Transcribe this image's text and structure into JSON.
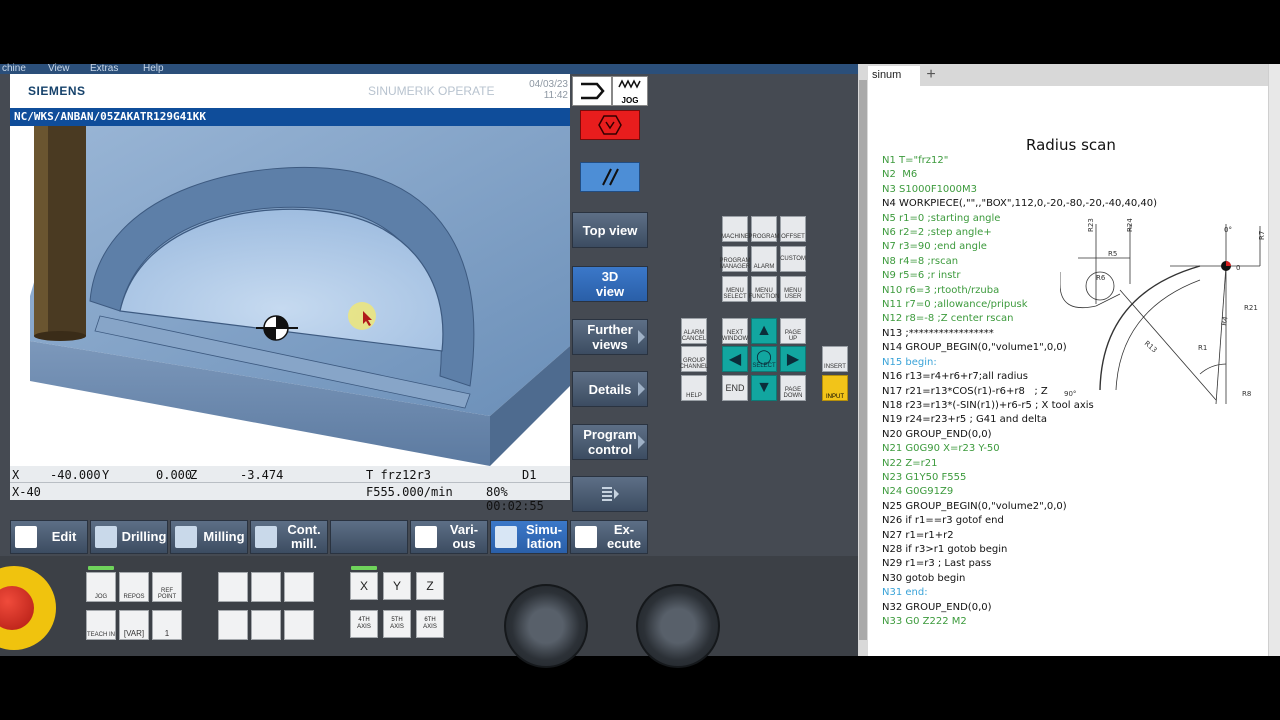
{
  "menu": [
    "chine",
    "View",
    "Extras",
    "Help"
  ],
  "header": {
    "brand": "SIEMENS",
    "product": "SINUMERIK OPERATE",
    "date": "04/03/23",
    "time": "11:42",
    "mode_label": "JOG"
  },
  "program_path": "NC/WKS/ANBAN/05ZAKATR129G41KK",
  "status": {
    "x_label": "X",
    "x_value": "-40.000",
    "y_label": "Y",
    "y_value": "0.000",
    "z_label": "Z",
    "z_value": "-3.474",
    "tool": "T frz12r3",
    "d": "D1",
    "block": "X-40",
    "feed": "F555.000/min",
    "override_time": "80% 00:02:55"
  },
  "vertical_softkeys": [
    "Top view",
    "3D view",
    "Further views",
    "Details",
    "Program control"
  ],
  "horizontal_softkeys": [
    {
      "label": "Edit"
    },
    {
      "label": "Drilling"
    },
    {
      "label": "Milling"
    },
    {
      "label": "Cont. mill."
    },
    {
      "label": ""
    },
    {
      "label": "Vari-ous"
    },
    {
      "label": "Simu-lation"
    },
    {
      "label": "Ex-ecute"
    }
  ],
  "keypad": {
    "row1": [
      "MACHINE",
      "PROGRAM",
      "OFFSET"
    ],
    "row2": [
      "PROGRAM MANAGER",
      "ALARM",
      "CUSTOM"
    ],
    "row3": [
      "MENU SELECT",
      "MENU FUNCTION",
      "MENU USER"
    ],
    "alarm_cancel": "ALARM CANCEL",
    "next_window": "NEXT WINDOW",
    "page_up": "PAGE UP",
    "group_channel": "GROUP CHANNEL",
    "select": "SELECT",
    "help": "HELP",
    "end": "END",
    "page_down": "PAGE DOWN",
    "insert": "INSERT",
    "input": "INPUT"
  },
  "machine_panel": {
    "mode_keys": [
      "JOG",
      "REPOS",
      "REF POINT"
    ],
    "mode_keys2": [
      "TEACH IN",
      "[VAR]",
      "1"
    ],
    "axis_keys": [
      "X",
      "Y",
      "Z"
    ],
    "axis_keys2": [
      "4TH AXIS",
      "5TH AXIS",
      "6TH AXIS"
    ]
  },
  "notepad": {
    "tab": "sinum",
    "title": "Radius scan",
    "lines": [
      {
        "t": "N1 T=\"frz12\"",
        "c": "g"
      },
      {
        "t": "N2  M6",
        "c": "g"
      },
      {
        "t": "N3 S1000F1000M3",
        "c": "g"
      },
      {
        "t": "N4 WORKPIECE(,\"\",,\"BOX\",112,0,-20,-80,-20,-40,40,40)",
        "c": "b"
      },
      {
        "t": "N5 r1=0 ;starting angle",
        "c": "g"
      },
      {
        "t": "N6 r2=2 ;step angle+",
        "c": "g"
      },
      {
        "t": "N7 r3=90 ;end angle",
        "c": "g"
      },
      {
        "t": "N8 r4=8 ;rscan",
        "c": "g"
      },
      {
        "t": "N9 r5=6 ;r instr",
        "c": "g"
      },
      {
        "t": "N10 r6=3 ;rtooth/rzuba",
        "c": "g"
      },
      {
        "t": "N11 r7=0 ;allowance/pripusk",
        "c": "g"
      },
      {
        "t": "N12 r8=-8 ;Z center rscan",
        "c": "g"
      },
      {
        "t": "N13 ;*****************",
        "c": "b"
      },
      {
        "t": "N14 GROUP_BEGIN(0,\"volume1\",0,0)",
        "c": "b"
      },
      {
        "t": "N15 begin:",
        "c": "c"
      },
      {
        "t": "N16 r13=r4+r6+r7;all radius",
        "c": "b"
      },
      {
        "t": "N17 r21=r13*COS(r1)-r6+r8   ; Z",
        "c": "b"
      },
      {
        "t": "N18 r23=r13*(-SIN(r1))+r6-r5 ; X tool axis",
        "c": "b"
      },
      {
        "t": "N19 r24=r23+r5 ; G41 and delta",
        "c": "b"
      },
      {
        "t": "N20 GROUP_END(0,0)",
        "c": "b"
      },
      {
        "t": "N21 G0G90 X=r23 Y-50",
        "c": "g"
      },
      {
        "t": "N22 Z=r21",
        "c": "g"
      },
      {
        "t": "N23 G1Y50 F555",
        "c": "g"
      },
      {
        "t": "N24 G0G91Z9",
        "c": "g"
      },
      {
        "t": "N25 GROUP_BEGIN(0,\"volume2\",0,0)",
        "c": "b"
      },
      {
        "t": "N26 if r1==r3 gotof end",
        "c": "b"
      },
      {
        "t": "N27 r1=r1+r2",
        "c": "b"
      },
      {
        "t": "N28 if r3>r1 gotob begin",
        "c": "b"
      },
      {
        "t": "N29 r1=r3 ; Last pass",
        "c": "b"
      },
      {
        "t": "N30 gotob begin",
        "c": "b"
      },
      {
        "t": "N31 end:",
        "c": "c"
      },
      {
        "t": "N32 GROUP_END(0,0)",
        "c": "b"
      },
      {
        "t": "N33 G0 Z222 M2",
        "c": "g"
      }
    ],
    "diagram_labels": {
      "r23": "R23",
      "r24": "R24",
      "r5": "R5",
      "zero_deg": "0°",
      "zero": "0",
      "r7": "R7",
      "r6": "R6",
      "r21": "R21",
      "r4": "R4",
      "r13": "R13",
      "r1": "R1",
      "deg90": "90°",
      "r8": "R8"
    }
  }
}
